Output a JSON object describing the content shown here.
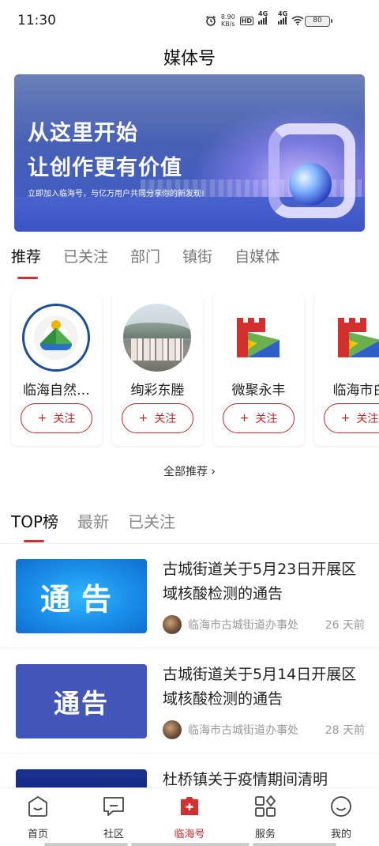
{
  "status_bar": {
    "time": "11:30",
    "net_speed_value": "8.90",
    "net_speed_unit": "KB/s",
    "hd_label": "HD",
    "sim1_label": "4G",
    "sim2_label": "4G",
    "battery": "80"
  },
  "header": {
    "title": "媒体号"
  },
  "banner": {
    "headline_1": "从这里开始",
    "headline_2": "让创作更有价值",
    "subtitle": "立即加入临海号，与亿万用户共同分享你的新发现!"
  },
  "category_tabs": [
    {
      "label": "推荐",
      "active": true
    },
    {
      "label": "已关注",
      "active": false
    },
    {
      "label": "部门",
      "active": false
    },
    {
      "label": "镇街",
      "active": false
    },
    {
      "label": "自媒体",
      "active": false
    }
  ],
  "recommend_cards": [
    {
      "name": "临海自然…",
      "avatar": "natural-resources-seal-icon"
    },
    {
      "name": "绚彩东塍",
      "avatar": "city-photo"
    },
    {
      "name": "微聚永丰",
      "avatar": "linhai-logo-icon"
    },
    {
      "name": "临海市白",
      "avatar": "linhai-logo-icon"
    }
  ],
  "follow_label": "关注",
  "follow_plus": "+",
  "more_recommend": "全部推荐",
  "list_tabs": [
    {
      "label": "TOP榜",
      "active": true
    },
    {
      "label": "最新",
      "active": false
    },
    {
      "label": "已关注",
      "active": false
    }
  ],
  "articles": [
    {
      "title": "古城街道关于5月23日开展区域核酸检测的通告",
      "thumb_text": "通告",
      "source": "临海市古城街道办事处",
      "time": "26  天前"
    },
    {
      "title": "古城街道关于5月14日开展区域核酸检测的通告",
      "thumb_text": "通告",
      "source": "临海市古城街道办事处",
      "time": "28  天前"
    },
    {
      "title": "杜桥镇关于疫情期间清明",
      "thumb_text": "",
      "source": "",
      "time": ""
    }
  ],
  "bottom_nav": [
    {
      "label": "首页",
      "icon": "home-face-icon",
      "active": false
    },
    {
      "label": "社区",
      "icon": "chat-bubble-icon",
      "active": false
    },
    {
      "label": "临海号",
      "icon": "plus-box-icon",
      "active": true
    },
    {
      "label": "服务",
      "icon": "grid-apps-icon",
      "active": false
    },
    {
      "label": "我的",
      "icon": "smiley-icon",
      "active": false
    }
  ],
  "colors": {
    "accent": "#c62828",
    "tab_indicator": "#d32f2f",
    "banner_blue": "#4760b5"
  }
}
